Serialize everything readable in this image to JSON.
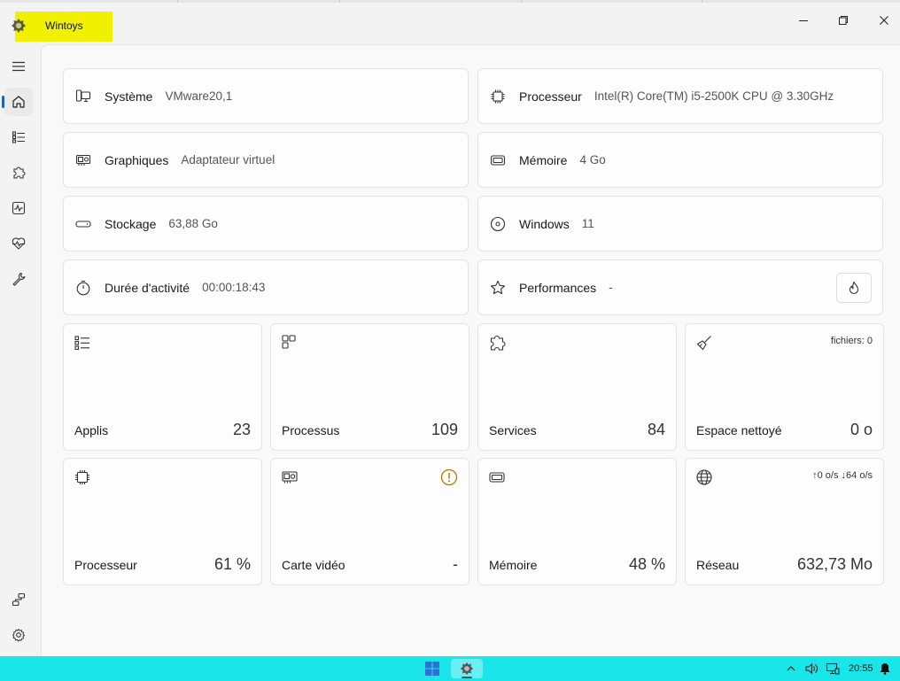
{
  "app": {
    "title": "Wintoys"
  },
  "window_controls": [
    {
      "name": "minimize-button",
      "icon": "minimize-icon"
    },
    {
      "name": "maximize-button",
      "icon": "restore-icon"
    },
    {
      "name": "close-button",
      "icon": "close-icon"
    }
  ],
  "sidebar": {
    "items": [
      {
        "icon": "hamburger-menu-icon"
      },
      {
        "icon": "home-icon",
        "active": true
      },
      {
        "icon": "apps-list-icon"
      },
      {
        "icon": "puzzle-icon"
      },
      {
        "icon": "activity-icon"
      },
      {
        "icon": "health-icon"
      },
      {
        "icon": "wrench-icon"
      }
    ],
    "bottom_items": [
      {
        "icon": "connection-icon"
      },
      {
        "icon": "settings-gear-icon"
      }
    ]
  },
  "info": {
    "system": {
      "label": "Système",
      "value": "VMware20,1",
      "icon": "pc-icon"
    },
    "processor": {
      "label": "Processeur",
      "value": "Intel(R) Core(TM) i5-2500K CPU @ 3.30GHz",
      "icon": "cpu-icon"
    },
    "graphics": {
      "label": "Graphiques",
      "value": "Adaptateur virtuel",
      "icon": "gpu-icon"
    },
    "memory": {
      "label": "Mémoire",
      "value": "4 Go",
      "icon": "memory-icon"
    },
    "storage": {
      "label": "Stockage",
      "value": "63,88 Go",
      "icon": "drive-icon"
    },
    "windows": {
      "label": "Windows",
      "value": "11",
      "icon": "disc-icon"
    },
    "uptime": {
      "label": "Durée d'activité",
      "value": "00:00:18:43",
      "icon": "timer-icon"
    },
    "performance": {
      "label": "Performances",
      "value": "-",
      "icon": "star-icon",
      "button_icon": "flame-icon"
    }
  },
  "tiles": {
    "apps": {
      "label": "Applis",
      "value": "23",
      "icon": "apps-list-icon"
    },
    "processes": {
      "label": "Processus",
      "value": "109",
      "icon": "processes-icon"
    },
    "services": {
      "label": "Services",
      "value": "84",
      "icon": "puzzle-icon"
    },
    "cleanup": {
      "label": "Espace nettoyé",
      "value": "0 o",
      "extra": "fichiers: 0",
      "icon": "broom-icon"
    },
    "cpu": {
      "label": "Processeur",
      "value": "61 %",
      "icon": "cpu-icon"
    },
    "gpu": {
      "label": "Carte vidéo",
      "value": "-",
      "icon": "gpu-icon",
      "warning_icon": "warning-circle-icon"
    },
    "ram": {
      "label": "Mémoire",
      "value": "48 %",
      "icon": "memory-icon"
    },
    "network": {
      "label": "Réseau",
      "value": "632,73 Mo",
      "extra": "↑0 o/s  ↓64 o/s",
      "icon": "globe-icon"
    }
  },
  "taskbar": {
    "color": "#1ae6ea",
    "items": [
      {
        "icon": "windows-start-icon"
      },
      {
        "icon": "wintoys-app-icon",
        "active": true
      }
    ],
    "tray": [
      {
        "icon": "chevron-up-icon"
      },
      {
        "icon": "speaker-icon"
      },
      {
        "icon": "network-monitor-icon"
      },
      {
        "icon": "notification-bell-icon"
      }
    ],
    "clock": "20:55"
  },
  "colors": {
    "accent": "#1f5fbf",
    "highlight": "#f0f000",
    "warning": "#b87a00"
  }
}
